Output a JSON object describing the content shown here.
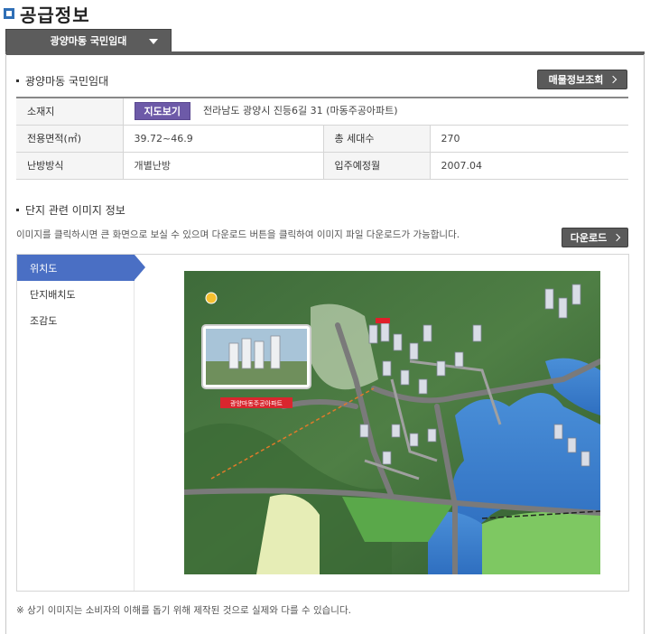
{
  "header": {
    "title": "공급정보"
  },
  "dropdown": {
    "label": "광양마동 국민임대"
  },
  "complex": {
    "title": "광양마동 국민임대",
    "listing_button": "매물정보조회"
  },
  "info": {
    "address_label": "소재지",
    "map_button": "지도보기",
    "address": "전라남도 광양시 진등6길 31  (마동주공아파트)",
    "area_label": "전용면적(㎡)",
    "area": "39.72~46.9",
    "households_label": "총 세대수",
    "households": "270",
    "heating_label": "난방방식",
    "heating": "개별난방",
    "move_in_label": "입주예정월",
    "move_in": "2007.04"
  },
  "images": {
    "title": "단지 관련 이미지 정보",
    "description": "이미지를 클릭하시면 큰 화면으로 보실 수 있으며 다운로드 버튼을 클릭하여 이미지 파일 다운로드가 가능합니다.",
    "download_button": "다운로드",
    "menu": [
      "위치도",
      "단지배치도",
      "조감도"
    ],
    "active_index": 0,
    "map_caption": "광양마동주공아파트"
  },
  "note": "※ 상기 이미지는 소비자의 이해를 돕기 위해 제작된 것으로 실제와 다를 수 있습니다.",
  "colors": {
    "accent_blue": "#4a6fc4",
    "map_button": "#6d5aa8",
    "dark_button": "#5a5a5a"
  }
}
